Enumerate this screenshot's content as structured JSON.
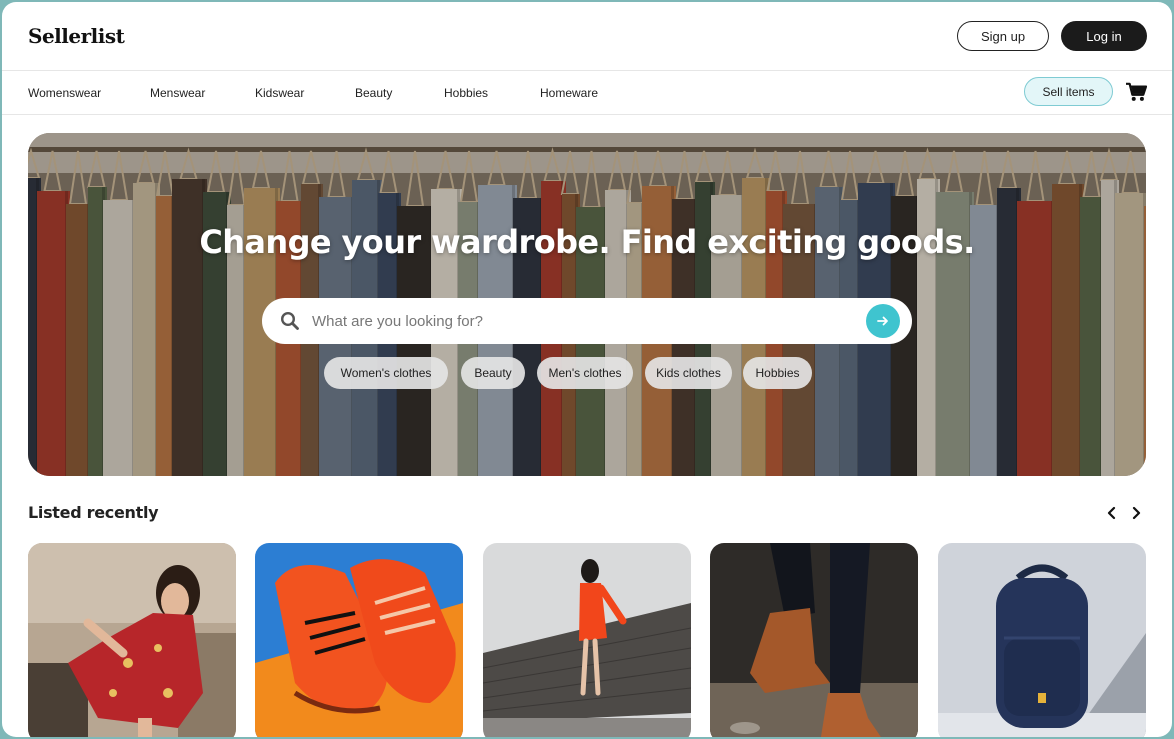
{
  "header": {
    "logo": "Sellerlist",
    "signup_label": "Sign up",
    "login_label": "Log in"
  },
  "nav": {
    "items": [
      {
        "label": "Womenswear"
      },
      {
        "label": "Menswear"
      },
      {
        "label": "Kidswear"
      },
      {
        "label": "Beauty"
      },
      {
        "label": "Hobbies"
      },
      {
        "label": "Homeware"
      }
    ],
    "sell_label": "Sell items",
    "cart_icon": "cart-icon"
  },
  "hero": {
    "title": "Change your wardrobe. Find exciting goods.",
    "search": {
      "placeholder": "What are you looking for?",
      "value": "",
      "icon": "search-icon",
      "submit_icon": "arrow-right-icon"
    },
    "chips": [
      {
        "label": "Women's clothes"
      },
      {
        "label": "Beauty"
      },
      {
        "label": "Men's clothes"
      },
      {
        "label": "Kids clothes"
      },
      {
        "label": "Hobbies"
      }
    ]
  },
  "recent": {
    "title": "Listed recently",
    "prev_icon": "chevron-left-icon",
    "next_icon": "chevron-right-icon",
    "items": [
      {
        "image": "woman-in-red-floral-dress"
      },
      {
        "image": "orange-sneakers"
      },
      {
        "image": "woman-in-orange-dress-on-wall"
      },
      {
        "image": "brown-ankle-boots"
      },
      {
        "image": "navy-backpack"
      }
    ]
  },
  "colors": {
    "accent": "#3fc4cf",
    "sell_bg": "#e3f6f8",
    "dark_button": "#1b1b1b"
  }
}
